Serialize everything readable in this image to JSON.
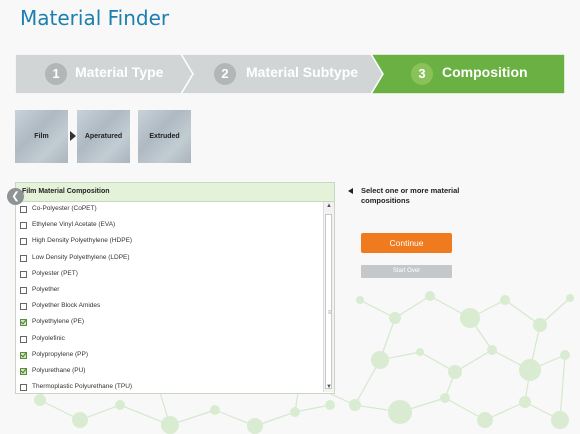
{
  "page_title": "Material Finder",
  "steps": [
    {
      "num": "1",
      "label": "Material Type",
      "state": "complete"
    },
    {
      "num": "2",
      "label": "Material Subtype",
      "state": "complete"
    },
    {
      "num": "3",
      "label": "Composition",
      "state": "active"
    }
  ],
  "breadcrumb_thumbs": [
    "Film",
    "Aperatured",
    "Extruded"
  ],
  "composition_panel": {
    "header": "Film Material Composition",
    "items": [
      {
        "label": "Co-Polyester (CoPET)",
        "checked": false
      },
      {
        "label": "Ethylene Vinyl Acetate (EVA)",
        "checked": false
      },
      {
        "label": "High Density Polyethylene (HDPE)",
        "checked": false
      },
      {
        "label": "Low Density Polyethylene (LDPE)",
        "checked": false
      },
      {
        "label": "Polyester (PET)",
        "checked": false
      },
      {
        "label": "Polyether",
        "checked": false
      },
      {
        "label": "Polyether Block Amides",
        "checked": false
      },
      {
        "label": "Polyethylene (PE)",
        "checked": true
      },
      {
        "label": "Polyolefinic",
        "checked": false
      },
      {
        "label": "Polypropylene (PP)",
        "checked": true
      },
      {
        "label": "Polyurethane (PU)",
        "checked": true
      },
      {
        "label": "Thermoplastic Polyurethane (TPU)",
        "checked": false
      }
    ]
  },
  "hint_text": "Select one or more material compositions",
  "buttons": {
    "continue": "Continue",
    "start_over": "Start Over"
  },
  "colors": {
    "title": "#1b7fb0",
    "step_inactive": "#d2d5d6",
    "step_active": "#6ab042",
    "continue": "#f07a1e",
    "panel_header": "#e5f2da"
  }
}
